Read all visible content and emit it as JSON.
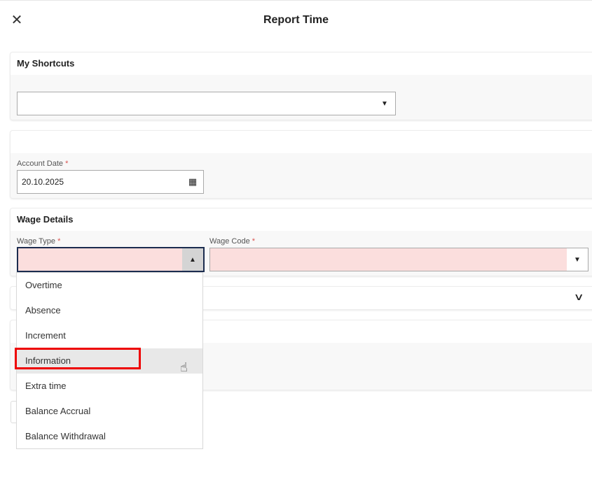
{
  "header": {
    "title": "Report Time",
    "close_icon": "close-icon"
  },
  "shortcuts": {
    "title": "My Shortcuts",
    "value": ""
  },
  "account": {
    "label": "Account Date",
    "required": "*",
    "value": "20.10.2025"
  },
  "wage": {
    "title": "Wage Details",
    "type_label": "Wage Type",
    "code_label": "Wage Code",
    "required": "*",
    "type_value": "",
    "code_value": ""
  },
  "wage_type_options": [
    "Overtime",
    "Absence",
    "Increment",
    "Information",
    "Extra time",
    "Balance Accrual",
    "Balance Withdrawal"
  ],
  "colors": {
    "error_bg": "#fbdedd",
    "focus_border": "#1b2c4f",
    "highlight": "#e00000"
  }
}
